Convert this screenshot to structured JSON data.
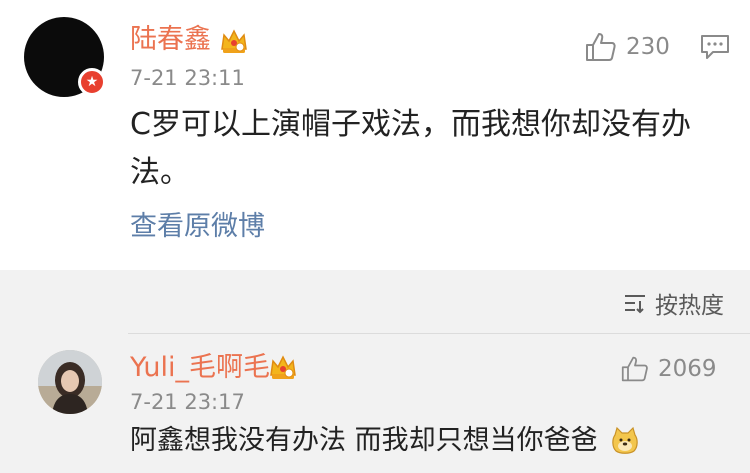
{
  "comment1": {
    "username": "陆春鑫",
    "time": "7-21 23:11",
    "likes": "230",
    "text": "C罗可以上演帽子戏法，而我想你却没有办法。",
    "view_link": "查看原微博",
    "icons": [
      "crown-icon",
      "verified-badge-icon",
      "thumbs-up-icon",
      "comment-icon"
    ]
  },
  "sort": {
    "label": "按热度"
  },
  "comment2": {
    "username": "Yuli_毛啊毛",
    "time": "7-21 23:17",
    "likes": "2069",
    "text": "阿鑫想我没有办法 而我却只想当你爸爸",
    "emoji": "doge-emoji"
  },
  "colors": {
    "name": "#eb7350",
    "link": "#5d7ea8",
    "muted": "#8a8a8a",
    "text": "#222222",
    "feed_bg": "#f2f2f2"
  }
}
